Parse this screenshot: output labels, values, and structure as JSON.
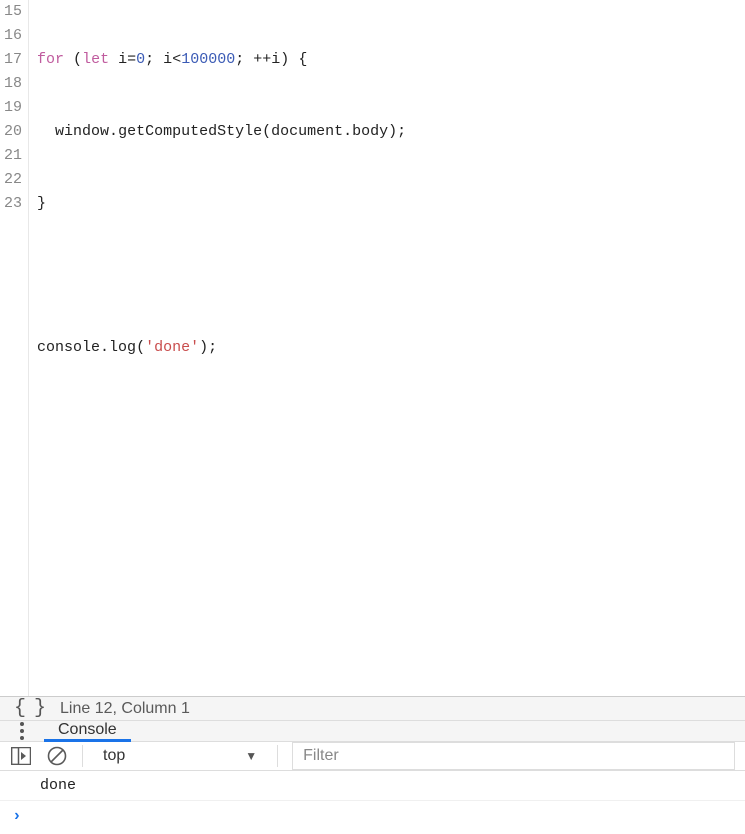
{
  "editor": {
    "lines": [
      {
        "num": "15"
      },
      {
        "num": "16"
      },
      {
        "num": "17"
      },
      {
        "num": "18"
      },
      {
        "num": "19"
      },
      {
        "num": "20"
      },
      {
        "num": "21"
      },
      {
        "num": "22"
      },
      {
        "num": "23"
      }
    ],
    "tokens": {
      "for_kw": "for",
      "let_kw": "let",
      "i_var": "i",
      "eq": "=",
      "zero": "0",
      "semi": ";",
      "lt": "<",
      "limit": "100000",
      "inc": "++",
      "space": " ",
      "open_paren": "(",
      "close_paren": ")",
      "open_brace": "{",
      "close_brace": "}",
      "window": "window",
      "dot": ".",
      "getComputedStyle": "getComputedStyle",
      "document": "document",
      "body": "body",
      "console": "console",
      "log": "log",
      "done_str": "'done'"
    }
  },
  "status": {
    "position": "Line 12, Column 1"
  },
  "tabs": {
    "console": "Console"
  },
  "toolbar": {
    "context": "top",
    "filter_placeholder": "Filter"
  },
  "console": {
    "output0": "done"
  }
}
